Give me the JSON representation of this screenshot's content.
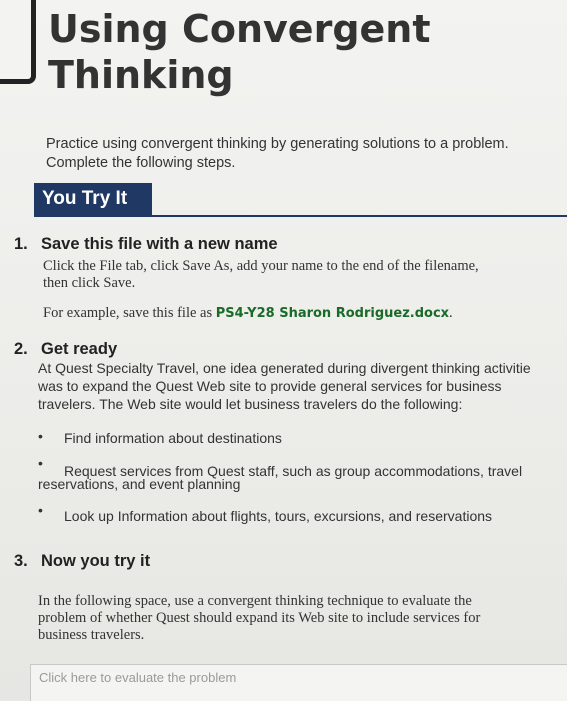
{
  "title_line1": "Using Convergent",
  "title_line2": "Thinking",
  "intro": {
    "line1": "Practice using convergent thinking by generating solutions to a problem.",
    "line2": "Complete the following steps."
  },
  "section_heading": "You Try It",
  "steps": [
    {
      "number": "1.",
      "title": "Save this file with a new name",
      "line1": "Click the File tab, click Save As, add your name to the end of the filename,",
      "line2": "then click Save.",
      "example_prefix": "For example, save this file as ",
      "example_filename": "PS4-Y28 Sharon Rodriguez.docx",
      "example_suffix": "."
    },
    {
      "number": "2.",
      "title": "Get ready",
      "line1": "At Quest Specialty Travel, one idea generated during divergent thinking activitie",
      "line2": "was to expand the Quest Web site to provide general services for business",
      "line3": "travelers. The Web site would let business travelers do the following:",
      "bullets": [
        {
          "line1": "Find information about destinations"
        },
        {
          "line1": "Request services from Quest staff, such as group accommodations, travel",
          "line2": "reservations, and event planning"
        },
        {
          "line1": "Look up Information about flights, tours, excursions, and reservations"
        }
      ]
    },
    {
      "number": "3.",
      "title": "Now you try it",
      "line1": "In the following space, use a convergent thinking technique to evaluate the",
      "line2": "problem of whether Quest should expand its Web site to include services for",
      "line3": "business travelers."
    }
  ],
  "response_placeholder": "Click here to evaluate the problem"
}
